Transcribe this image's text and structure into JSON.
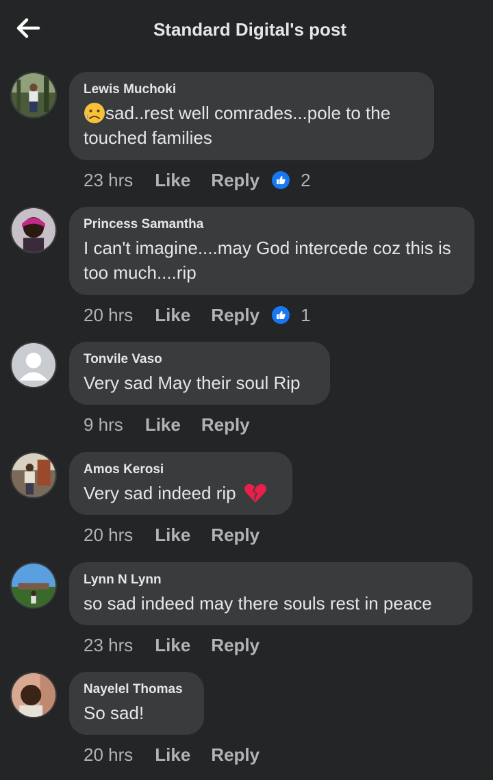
{
  "header": {
    "title": "Standard Digital's post",
    "back_icon": "arrow-left-icon"
  },
  "colors": {
    "background": "#242526",
    "bubble": "#3a3b3c",
    "like_badge": "#1877f2",
    "meta_text": "#b0b3b8"
  },
  "actions": {
    "like": "Like",
    "reply": "Reply"
  },
  "comments": [
    {
      "author": "Lewis Muchoki",
      "text": "sad..rest well comrades...pole to the touched families",
      "leading_emoji": "sad-but-relieved-face",
      "time": "23 hrs",
      "reactions": "2"
    },
    {
      "author": "Princess Samantha",
      "text": "I can't imagine....may God intercede coz this is too much....rip",
      "time": "20 hrs",
      "reactions": "1"
    },
    {
      "author": "Tonvile Vaso",
      "text": "Very sad May their soul Rip",
      "time": "9 hrs"
    },
    {
      "author": "Amos Kerosi",
      "text": "Very sad indeed rip",
      "trailing_emoji": "broken-heart",
      "time": "20 hrs"
    },
    {
      "author": "Lynn N Lynn",
      "text": "so sad indeed may there souls rest in peace",
      "time": "23 hrs"
    },
    {
      "author": "Nayelel Thomas",
      "text": "So sad!",
      "time": "20 hrs"
    }
  ]
}
